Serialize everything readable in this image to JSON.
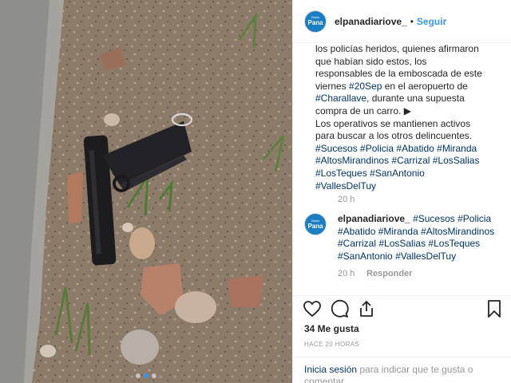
{
  "header": {
    "avatar_top": "Diario",
    "avatar_main": "Pana",
    "username": "elpanadiariove_",
    "separator": "•",
    "follow": "Seguir"
  },
  "caption": {
    "lines": [
      "los policías heridos, quienes afirmaron",
      "que habían sido estos, los",
      "responsables de la emboscada de este"
    ],
    "line4_pre": "viernes ",
    "line4_tag": "#20Sep",
    "line4_post": " en el aeropuerto de",
    "line5_tag": "#Charallave",
    "line5_post": ", durante una supuesta",
    "line6": "compra de un carro. ▶",
    "line7": "Los operativos se mantienen activos",
    "line8": "para buscar a los otros delincuentes.",
    "tags_line1": [
      "#Sucesos",
      "#Policia",
      "#Abatido",
      "#Miranda"
    ],
    "tags_line2": [
      "#AltosMirandinos",
      "#Carrizal",
      "#LosSalias"
    ],
    "tags_line3": [
      "#LosTeques",
      "#SanAntonio"
    ],
    "tags_line4": [
      "#VallesDelTuy"
    ],
    "time": "20 h"
  },
  "comment": {
    "username": "elpanadiariove_",
    "tags_line1": [
      "#Sucesos",
      "#Policia"
    ],
    "tags_line2": [
      "#Abatido",
      "#Miranda",
      "#AltosMirandinos"
    ],
    "tags_line3": [
      "#Carrizal",
      "#LosSalias",
      "#LosTeques"
    ],
    "tags_line4": [
      "#SanAntonio",
      "#VallesDelTuy"
    ],
    "time": "20 h",
    "reply": "Responder"
  },
  "actions": {
    "icons": [
      "heart-icon",
      "comment-icon",
      "share-icon",
      "bookmark-icon"
    ],
    "likes": "34 Me gusta",
    "ago": "HACE 20 HORAS",
    "login_link": "Inicia sesión",
    "login_text": " para indicar que te gusta o",
    "login_text2": "comentar."
  },
  "carousel": {
    "dots": 3,
    "active_index": 1
  },
  "colors": {
    "link": "#3897f0",
    "hashtag": "#003569",
    "muted": "#999999",
    "avatar_bg": "#1a7ec4"
  }
}
